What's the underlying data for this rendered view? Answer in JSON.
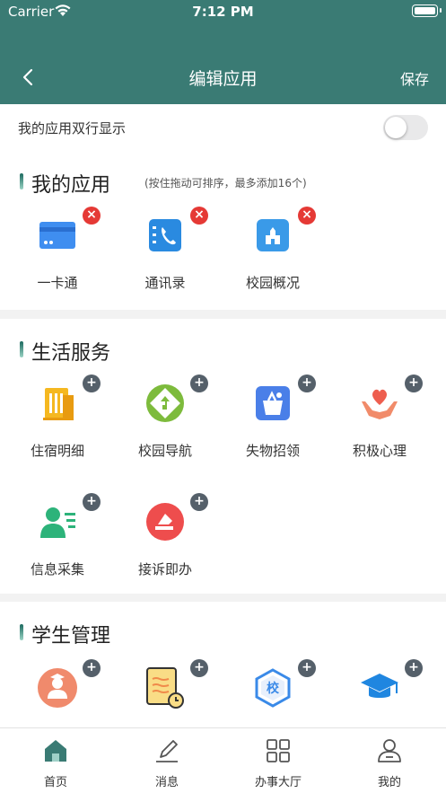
{
  "status_bar": {
    "carrier": "Carrier",
    "time": "7:12 PM"
  },
  "nav": {
    "title": "编辑应用",
    "save_label": "保存"
  },
  "toggle_row": {
    "label": "我的应用双行显示",
    "enabled": false
  },
  "my_apps": {
    "title": "我的应用",
    "hint": "(按住拖动可排序，最多添加16个)",
    "items": [
      {
        "label": "一卡通",
        "icon": "card-icon"
      },
      {
        "label": "通讯录",
        "icon": "contacts-icon"
      },
      {
        "label": "校园概况",
        "icon": "campus-overview-icon"
      }
    ]
  },
  "life_services": {
    "title": "生活服务",
    "items": [
      {
        "label": "住宿明细",
        "icon": "dormitory-icon"
      },
      {
        "label": "校园导航",
        "icon": "navigation-icon"
      },
      {
        "label": "失物招领",
        "icon": "lost-found-icon"
      },
      {
        "label": "积极心理",
        "icon": "psychology-icon"
      },
      {
        "label": "信息采集",
        "icon": "info-collect-icon"
      },
      {
        "label": "接诉即办",
        "icon": "complaint-icon"
      }
    ]
  },
  "student_mgmt": {
    "title": "学生管理",
    "items": [
      {
        "label": "",
        "icon": "teacher-icon"
      },
      {
        "label": "",
        "icon": "document-clock-icon"
      },
      {
        "label": "",
        "icon": "school-badge-icon"
      },
      {
        "label": "",
        "icon": "graduation-cap-icon"
      }
    ],
    "school_badge_char": "校"
  },
  "tabbar": {
    "items": [
      {
        "label": "首页",
        "icon": "home-icon",
        "active": true
      },
      {
        "label": "消息",
        "icon": "message-pen-icon",
        "active": false
      },
      {
        "label": "办事大厅",
        "icon": "grid-icon",
        "active": false
      },
      {
        "label": "我的",
        "icon": "user-icon",
        "active": false
      }
    ]
  },
  "colors": {
    "header": "#3a7b74",
    "remove_badge": "#e53935",
    "add_badge": "#55606a",
    "active_tab": "#3a7b74"
  }
}
